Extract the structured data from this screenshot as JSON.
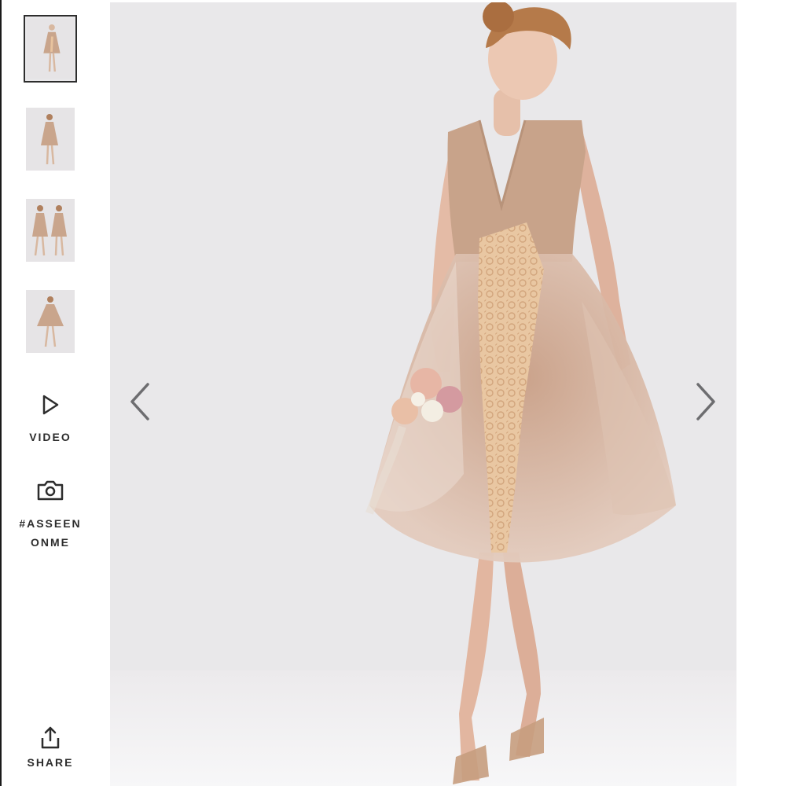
{
  "gallery": {
    "thumbnails": [
      {
        "name": "front view",
        "active": true
      },
      {
        "name": "back view",
        "active": false
      },
      {
        "name": "two models",
        "active": false
      },
      {
        "name": "full length",
        "active": false
      }
    ],
    "video_label": "VIDEO",
    "as_seen_on_me_line1": "#ASSEEN",
    "as_seen_on_me_line2": "ONME",
    "share_label": "SHARE",
    "icons": [
      "play-icon",
      "camera-icon",
      "share-icon",
      "chevron-left-icon",
      "chevron-right-icon"
    ]
  },
  "colors": {
    "text": "#2d2d2d",
    "backdrop": "#e9e8ea",
    "dress": "#c9a58c",
    "lace": "#e8c39e"
  }
}
